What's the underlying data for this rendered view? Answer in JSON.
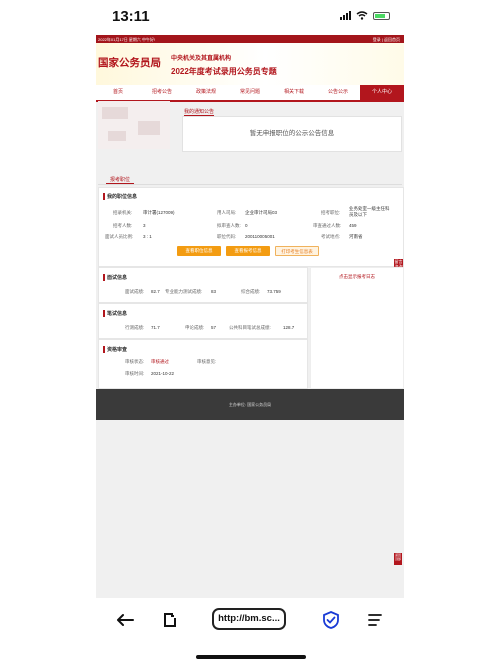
{
  "status_bar": {
    "time": "13:11"
  },
  "header": {
    "top_left": "2022年01月17日 星期六 中午好!",
    "top_right": "登录 | 返回首页",
    "logo": "国家公务员局",
    "org": "中央机关及其直属机构",
    "subtitle": "2022年度考试录用公务员专题"
  },
  "nav": {
    "items": [
      "首页",
      "招考公告",
      "政策法规",
      "常见问题",
      "相关下载",
      "公告公示",
      "个人中心"
    ],
    "active_index": 6
  },
  "notice": {
    "tab": "我的通知公告",
    "empty_text": "暂无申报职位的公示公告信息"
  },
  "apply_section": {
    "tab": "报考职位",
    "title": "我的职位信息",
    "fields": [
      {
        "label": "招录机关:",
        "value": "审计署(127009)"
      },
      {
        "label": "用人司局:",
        "value": "企业审计司局03"
      },
      {
        "label": "招考职位:",
        "value": "业务处室一级主任科员及以下"
      },
      {
        "label": "招考人数:",
        "value": "3"
      },
      {
        "label": "拟审查人数:",
        "value": "0"
      },
      {
        "label": "审查通过人数:",
        "value": "459"
      },
      {
        "label": "面试人员比例:",
        "value": "3 : 1"
      },
      {
        "label": "职位代码:",
        "value": "200110005001"
      },
      {
        "label": "考试地点:",
        "value": "河南省"
      }
    ],
    "buttons": [
      "查看职位信息",
      "查看报考信息",
      "打印考生信息表"
    ]
  },
  "side_tab": "留言\n咨询\n在线\n考试",
  "side_box_text": "点击显示报考日志",
  "interview": {
    "title": "面试信息",
    "fields": [
      {
        "label": "面试成绩:",
        "value": "82.7"
      },
      {
        "label": "专业能力测试成绩:",
        "value": "83"
      },
      {
        "label": "综合成绩:",
        "value": "73.759"
      }
    ]
  },
  "written": {
    "title": "笔试信息",
    "fields": [
      {
        "label": "行测成绩:",
        "value": "71.7"
      },
      {
        "label": "申论成绩:",
        "value": "57"
      },
      {
        "label": "公共科目笔试总成绩:",
        "value": "128.7"
      }
    ]
  },
  "review": {
    "title": "资格审查",
    "fields": [
      {
        "label": "审核状态:",
        "value": "审核通过"
      },
      {
        "label": "审核意见:",
        "value": ""
      },
      {
        "label": "审核时间:",
        "value": "2021-10-22"
      }
    ]
  },
  "footer": {
    "text": "主办单位: 国家公务员局"
  },
  "corner_badge": "返回顶部",
  "browser": {
    "url": "http://bm.sc...",
    "icons": [
      "back-arrow-icon",
      "tabs-icon",
      "shield-check-icon",
      "menu-icon"
    ]
  }
}
